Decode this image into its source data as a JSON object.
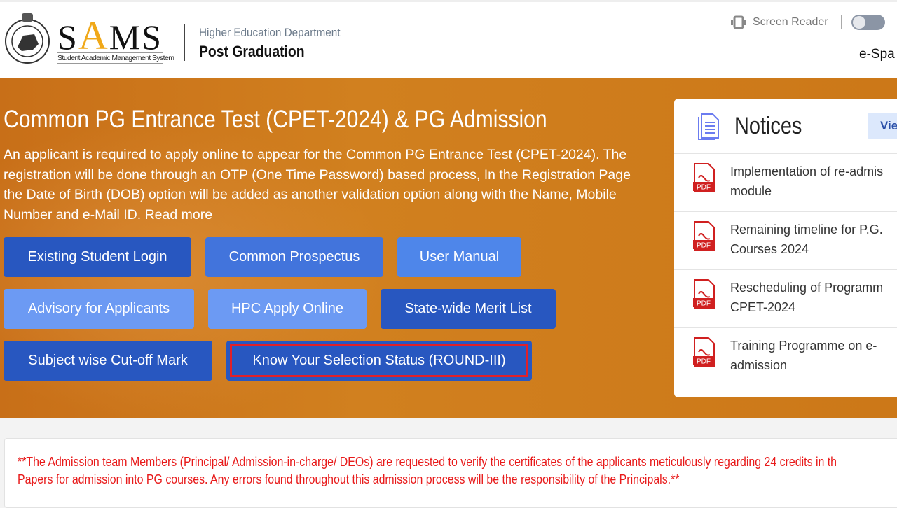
{
  "header": {
    "logo_text": "SAMS",
    "logo_subtitle": "Student Academic Management System",
    "department": "Higher Education Department",
    "section": "Post Graduation",
    "screen_reader_label": "Screen Reader",
    "screen_reader_on": false,
    "language_label": "e-Spa"
  },
  "banner": {
    "title": "Common PG Entrance Test (CPET-2024) & PG Admission",
    "description": "An applicant is required to apply online to appear for the Common PG Entrance Test (CPET-2024). The registration will be done through an OTP (One Time Password) based process, In the Registration Page the Date of Birth (DOB) option will be added as another validation option along with the Name, Mobile Number and e-Mail ID. ",
    "read_more": "Read more",
    "buttons": [
      "Existing Student Login",
      "Common Prospectus",
      "User Manual",
      "Advisory for Applicants",
      "HPC Apply Online",
      "State-wide Merit List",
      "Subject wise Cut-off Mark",
      "Know Your Selection Status (ROUND-III)"
    ]
  },
  "notices": {
    "title": "Notices",
    "view_label": "Vie",
    "icon": "document-icon",
    "items": [
      {
        "icon": "pdf-icon",
        "text": "Implementation of re-admis\nmodule"
      },
      {
        "icon": "pdf-icon",
        "text": "Remaining timeline for P.G.\nCourses 2024"
      },
      {
        "icon": "pdf-icon",
        "text": "Rescheduling of Programm\nCPET-2024"
      },
      {
        "icon": "pdf-icon",
        "text": "Training Programme on e-\nadmission"
      }
    ]
  },
  "alert": {
    "text": "**The Admission team Members (Principal/ Admission-in-charge/ DEOs) are requested to verify the certificates of the applicants meticulously regarding 24 credits in th\nPapers for admission into PG courses. Any errors found throughout this admission process will be the responsibility of the Principals.**",
    "color": "#e81a1a"
  },
  "colors": {
    "banner": "#cc7818",
    "button_dark": "#2857c0",
    "button_mid": "#4274dc",
    "button_light": "#4e86ea",
    "button_lighter": "#6c9af3",
    "highlight": "#e0202a"
  }
}
